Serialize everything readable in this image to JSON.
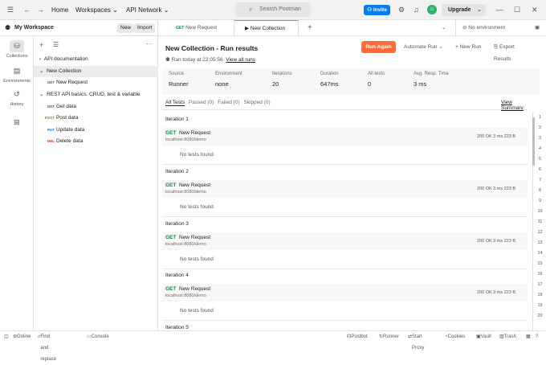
{
  "topbar": {
    "home": "Home",
    "workspaces": "Workspaces",
    "api_network": "API Network",
    "search_placeholder": "Search Postman",
    "invite": "Invite",
    "upgrade": "Upgrade"
  },
  "workspace": {
    "name": "My Workspace",
    "new_btn": "New",
    "import_btn": "Import"
  },
  "rail": [
    {
      "label": "Collections",
      "icon": "collections-icon"
    },
    {
      "label": "Environments",
      "icon": "environments-icon"
    },
    {
      "label": "History",
      "icon": "history-icon"
    },
    {
      "label": "",
      "icon": "apps-icon"
    }
  ],
  "tree": [
    {
      "label": "API documentation",
      "chevron": "›"
    },
    {
      "label": "New Collection",
      "chevron": "⌄"
    },
    {
      "label": "New Request",
      "method": "GET"
    },
    {
      "label": "REST API basics: CRUD, test & variable",
      "chevron": "⌄"
    },
    {
      "label": "Get data",
      "method": "GET"
    },
    {
      "label": "Post data",
      "method": "POST"
    },
    {
      "label": "Update data",
      "method": "PUT"
    },
    {
      "label": "Delete data",
      "method": "DEL"
    }
  ],
  "tabs": {
    "tab1_method": "GET",
    "tab1_label": "New Request",
    "tab2_label": "New Collection",
    "env": "No environment"
  },
  "run": {
    "title": "New Collection - Run results",
    "ran": "Ran today at 22:05:56",
    "view_runs": "View all runs",
    "run_again": "Run Again",
    "automate": "Automate Run",
    "new_run": "New Run",
    "export": "Export Results"
  },
  "stats": [
    {
      "k": "Source",
      "v": "Runner"
    },
    {
      "k": "Environment",
      "v": "none"
    },
    {
      "k": "Iterations",
      "v": "20"
    },
    {
      "k": "Duration",
      "v": "647ms"
    },
    {
      "k": "All tests",
      "v": "0"
    },
    {
      "k": "Avg. Resp. Time",
      "v": "3 ms"
    }
  ],
  "filters": {
    "all": "All Tests",
    "passed": "Passed (0)",
    "failed": "Failed (0)",
    "skipped": "Skipped (0)",
    "view_summary": "View Summary"
  },
  "iterations": [
    {
      "h": "Iteration 1",
      "m": "GET",
      "name": "New Request",
      "url": "localhost:8080/demo",
      "status": "200 OK   3 ms   223 B",
      "note": "No tests found"
    },
    {
      "h": "Iteration 2",
      "m": "GET",
      "name": "New Request",
      "url": "localhost:8080/demo",
      "status": "200 OK   3 ms   223 B",
      "note": "No tests found"
    },
    {
      "h": "Iteration 3",
      "m": "GET",
      "name": "New Request",
      "url": "localhost:8080/demo",
      "status": "200 OK   3 ms   223 B",
      "note": "No tests found"
    },
    {
      "h": "Iteration 4",
      "m": "GET",
      "name": "New Request",
      "url": "localhost:8080/demo",
      "status": "200 OK   3 ms   223 B",
      "note": "No tests found"
    },
    {
      "h": "Iteration 5"
    }
  ],
  "gutter": [
    "1",
    "2",
    "3",
    "4",
    "5",
    "6",
    "7",
    "8",
    "9",
    "10",
    "11",
    "12",
    "13",
    "14",
    "15",
    "16",
    "17",
    "18",
    "19",
    "20"
  ],
  "statusbar": {
    "online": "Online",
    "find": "Find and replace",
    "console": "Console",
    "postbot": "Postbot",
    "runner": "Runner",
    "proxy": "Start Proxy",
    "cookies": "Cookies",
    "vault": "Vault",
    "trash": "Trash"
  }
}
